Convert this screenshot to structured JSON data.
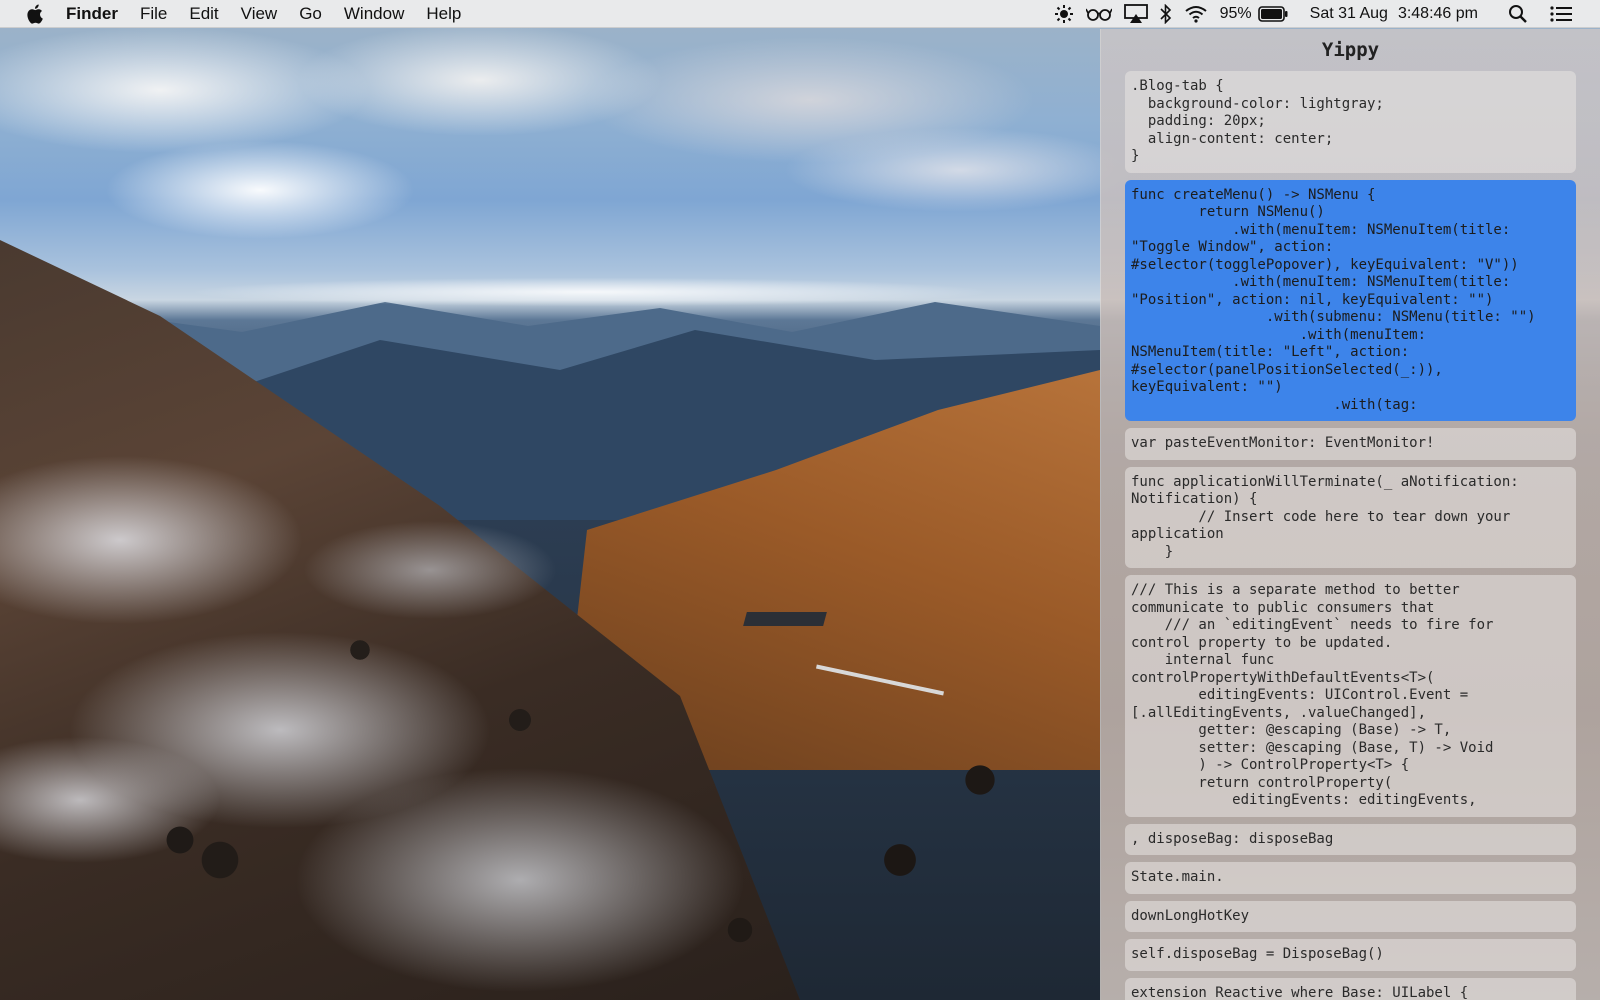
{
  "menubar": {
    "app_name": "Finder",
    "menus": [
      "File",
      "Edit",
      "View",
      "Go",
      "Window",
      "Help"
    ],
    "status": {
      "battery_percent": "95%",
      "date": "Sat 31 Aug",
      "time": "3:48:46 pm",
      "icons": [
        "brightness-icon",
        "glasses-icon",
        "airplay-icon",
        "bluetooth-icon",
        "wifi-icon",
        "battery-icon",
        "spotlight-icon",
        "notification-center-icon"
      ]
    }
  },
  "panel": {
    "title": "Yippy",
    "selected_index": 1,
    "clips": [
      {
        "lines": [
          ".Blog-tab {",
          "  background-color: lightgray;",
          "  padding: 20px;",
          "  align-content: center;",
          "}"
        ]
      },
      {
        "lines": [
          "func createMenu() -> NSMenu {",
          "        return NSMenu()",
          "            .with(menuItem: NSMenuItem(title:",
          "\"Toggle Window\", action:",
          "#selector(togglePopover), keyEquivalent: \"V\"))",
          "            .with(menuItem: NSMenuItem(title:",
          "\"Position\", action: nil, keyEquivalent: \"\")",
          "                .with(submenu: NSMenu(title: \"\")",
          "                    .with(menuItem:",
          "NSMenuItem(title: \"Left\", action:",
          "#selector(panelPositionSelected(_:)),",
          "keyEquivalent: \"\")",
          "                        .with(tag:"
        ]
      },
      {
        "lines": [
          "var pasteEventMonitor: EventMonitor!"
        ]
      },
      {
        "lines": [
          "func applicationWillTerminate(_ aNotification:",
          "Notification) {",
          "        // Insert code here to tear down your",
          "application",
          "    }"
        ]
      },
      {
        "lines": [
          "/// This is a separate method to better",
          "communicate to public consumers that",
          "    /// an `editingEvent` needs to fire for",
          "control property to be updated.",
          "    internal func",
          "controlPropertyWithDefaultEvents<T>(",
          "        editingEvents: UIControl.Event =",
          "[.allEditingEvents, .valueChanged],",
          "        getter: @escaping (Base) -> T,",
          "        setter: @escaping (Base, T) -> Void",
          "        ) -> ControlProperty<T> {",
          "        return controlProperty(",
          "            editingEvents: editingEvents,"
        ]
      },
      {
        "lines": [
          ", disposeBag: disposeBag"
        ]
      },
      {
        "lines": [
          "State.main."
        ]
      },
      {
        "lines": [
          "downLongHotKey"
        ]
      },
      {
        "lines": [
          "self.disposeBag = DisposeBag()"
        ]
      },
      {
        "lines": [
          "extension Reactive where Base: UILabel {"
        ]
      }
    ]
  }
}
